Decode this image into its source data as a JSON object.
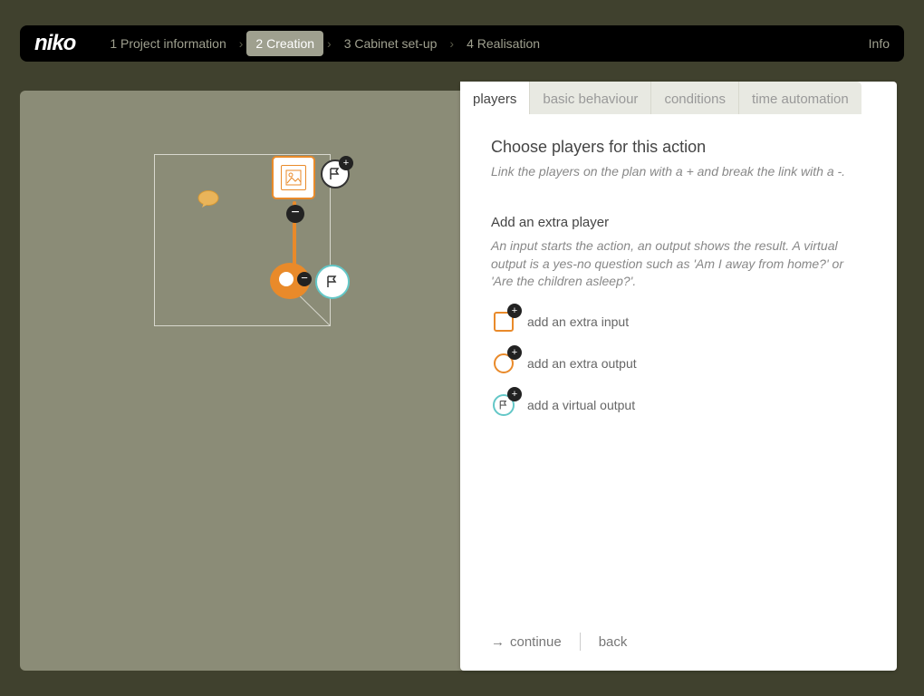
{
  "brand": "niko",
  "steps": {
    "s1": "1 Project information",
    "s2": "2 Creation",
    "s3": "3 Cabinet set-up",
    "s4": "4 Realisation",
    "info": "Info"
  },
  "tabs": {
    "players": "players",
    "basic": "basic behaviour",
    "conditions": "conditions",
    "time": "time automation"
  },
  "panel": {
    "title": "Choose players for this action",
    "desc": "Link the players on the plan with a + and break the link with a -.",
    "subhead": "Add an extra player",
    "help": "An input starts the action, an output shows the result.\nA virtual output is a yes-no question such as 'Am I away from home?' or 'Are the children asleep?'.",
    "add_input": "add an extra input",
    "add_output": "add an extra output",
    "add_virtual": "add a virtual output",
    "continue": "continue",
    "back": "back"
  }
}
